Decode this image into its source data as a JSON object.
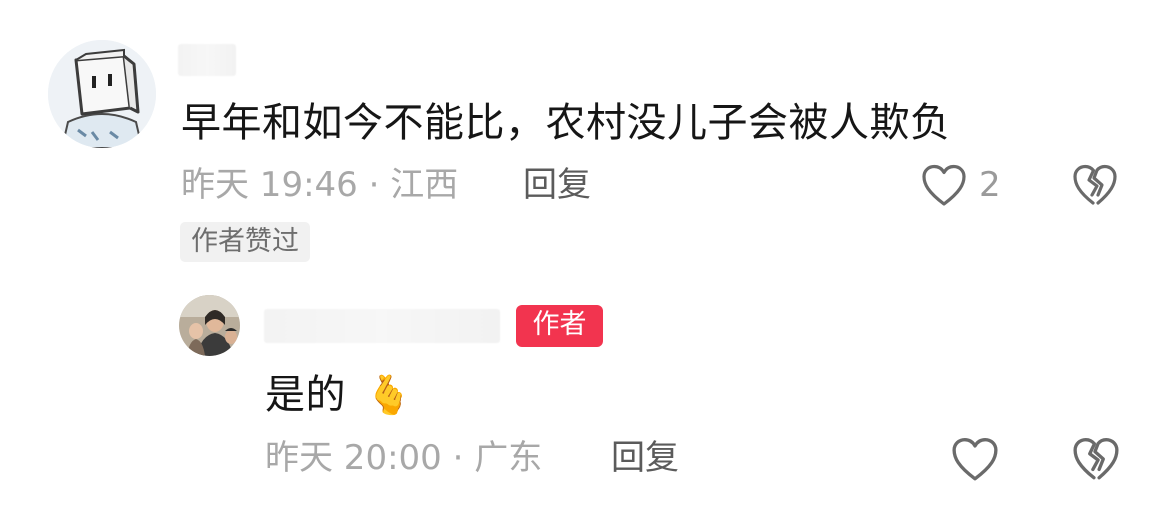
{
  "comment": {
    "text": "早年和如今不能比，农村没儿子会被人欺负",
    "meta": "昨天 19:46 · 江西",
    "reply_label": "回复",
    "like_count": "2",
    "author_liked_label": "作者赞过"
  },
  "reply": {
    "author_badge": "作者",
    "text": "是的",
    "emoji": "🫰",
    "meta": "昨天 20:00 · 广东",
    "reply_label": "回复"
  },
  "colors": {
    "author_badge": "#f2344f",
    "meta_text": "#a8a8a8"
  },
  "icons": {
    "like": "heart-outline-icon",
    "dislike": "broken-heart-icon",
    "emoji": "hand-with-index-finger-and-thumb-crossed-emoji"
  }
}
